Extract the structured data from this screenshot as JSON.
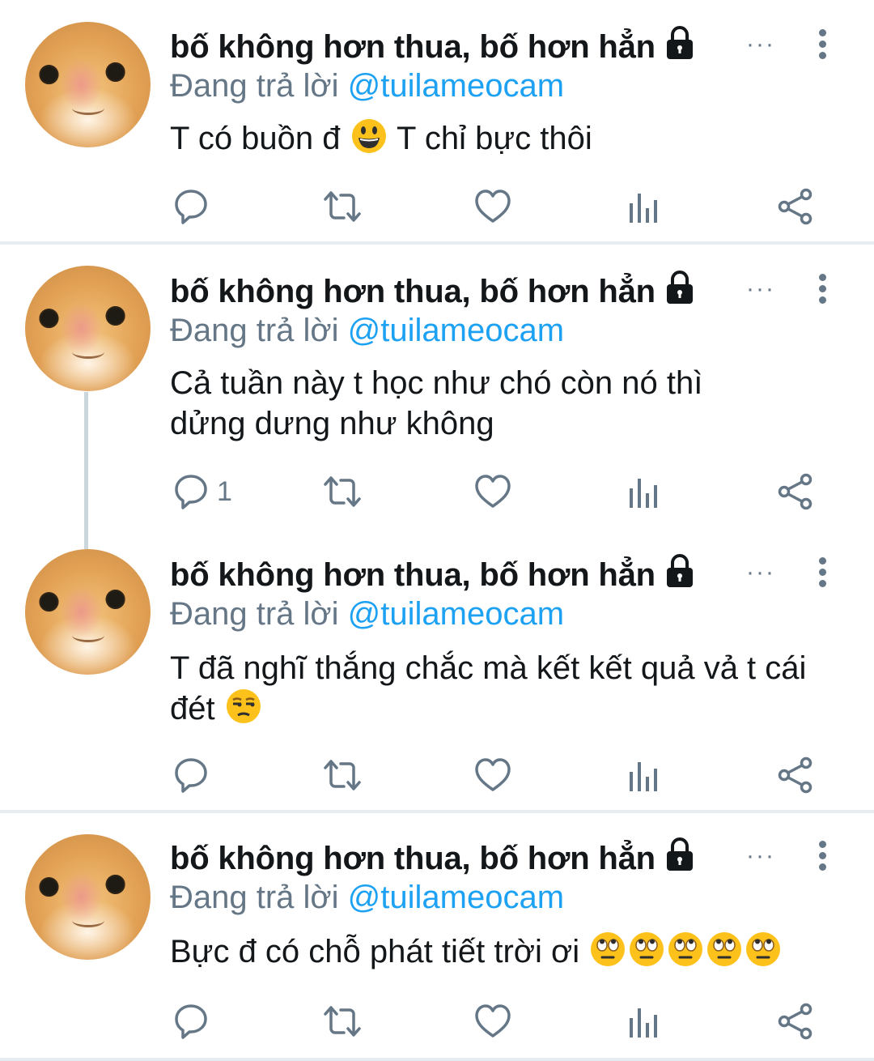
{
  "tweets": [
    {
      "display_name": "bố không hơn thua, bố hơn hẳn",
      "replying_prefix": "Đang trả lời",
      "replying_handle": "@tuilameocam",
      "text_before": "T có buồn đ",
      "emoji": "grinning-face",
      "text_after": "T chỉ bực thôi",
      "reply_count": "",
      "more_dots": "···"
    },
    {
      "display_name": "bố không hơn thua, bố hơn hẳn",
      "replying_prefix": "Đang trả lời",
      "replying_handle": "@tuilameocam",
      "text": "Cả tuần này t học như chó còn nó thì dửng dưng như không",
      "reply_count": "1",
      "more_dots": "···"
    },
    {
      "display_name": "bố không hơn thua, bố hơn hẳn",
      "replying_prefix": "Đang trả lời",
      "replying_handle": "@tuilameocam",
      "text_before": "T đã nghĩ thắng chắc mà kết kết quả vả t cái đét",
      "emoji": "unamused-face",
      "reply_count": "",
      "more_dots": "···"
    },
    {
      "display_name": "bố không hơn thua, bố hơn hẳn",
      "replying_prefix": "Đang trả lời",
      "replying_handle": "@tuilameocam",
      "text_before": "Bực đ có chỗ phát tiết trời ơi",
      "emoji": "face-with-rolling-eyes",
      "emoji_repeat": 5,
      "reply_count": "",
      "more_dots": "···"
    }
  ],
  "colors": {
    "text": "#14171a",
    "secondary": "#657786",
    "link": "#1da1f2",
    "divider": "#e6ecf0",
    "thread_line": "#ccd6dd"
  },
  "icons": [
    "lock-icon",
    "more-dots-icon",
    "kebab-menu-icon",
    "reply-icon",
    "retweet-icon",
    "like-icon",
    "analytics-icon",
    "share-icon"
  ]
}
